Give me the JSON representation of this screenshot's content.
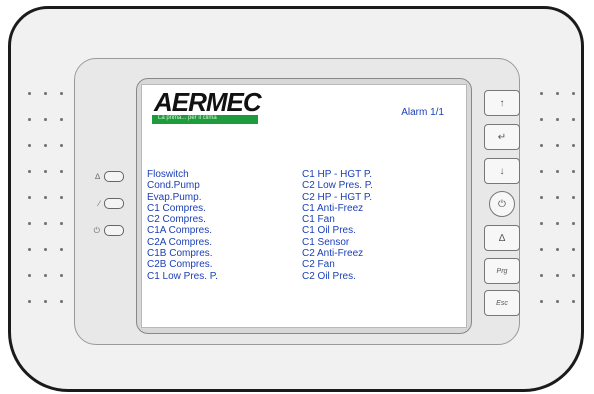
{
  "logo": {
    "brand": "AERMEC",
    "tagline": "La prima...   per il clima"
  },
  "alarm": {
    "label": "Alarm 1/1"
  },
  "alarms": {
    "left": [
      "Floswitch",
      "Cond.Pump",
      "Evap.Pump.",
      "C1 Compres.",
      "C2 Compres.",
      "C1A Compres.",
      "C2A Compres.",
      "C1B Compres.",
      "C2B Compres.",
      "C1 Low Pres. P."
    ],
    "right": [
      "C1 HP - HGT  P.",
      "C2 Low Pres. P.",
      "C2 HP - HGT  P.",
      "C1 Anti-Freez",
      "C1 Fan",
      "C1 Oil Pres.",
      "C1 Sensor",
      "C2 Anti-Freez",
      "C2 Fan",
      "C2 Oil Pres."
    ]
  },
  "indicators": [
    {
      "icon": "alarm-bell-icon",
      "glyph": "∆"
    },
    {
      "icon": "wrench-icon",
      "glyph": "∕"
    },
    {
      "icon": "power-icon",
      "glyph": "⏻"
    }
  ],
  "buttons": {
    "up": "↑",
    "enter": "↵",
    "down": "↓",
    "power": "⏻",
    "alarm": "∆",
    "prg": "Prg",
    "esc": "Esc"
  },
  "colors": {
    "text": "#1a3fb7",
    "logo_bar": "#1e9b3c"
  }
}
